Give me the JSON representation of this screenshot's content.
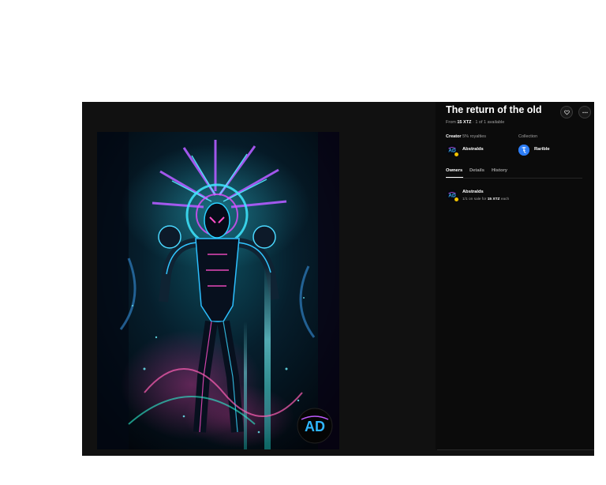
{
  "item": {
    "title": "The return of the old",
    "price_prefix": "From",
    "price": "15 XTZ",
    "separator": "·",
    "availability": "1 of 1 available"
  },
  "creator": {
    "label": "Creator",
    "royalties": "5% royalties",
    "name": "Abstralds"
  },
  "collection": {
    "label": "Collection",
    "name": "Rarible"
  },
  "tabs": [
    {
      "label": "Owners",
      "active": true
    },
    {
      "label": "Details",
      "active": false
    },
    {
      "label": "History",
      "active": false
    }
  ],
  "owner": {
    "name": "Abstralds",
    "sale_prefix": "1/1 on sale for",
    "sale_price": "15 XTZ",
    "sale_suffix": "each"
  },
  "icons": {
    "like": "heart-icon",
    "more": "more-icon",
    "collection_logo": "tezos-icon",
    "verified": "verified-badge-icon"
  },
  "colors": {
    "background": "#111111",
    "panel": "#0b0b0b",
    "tezos_blue": "#2c7df7",
    "verified": "#f2c200"
  }
}
